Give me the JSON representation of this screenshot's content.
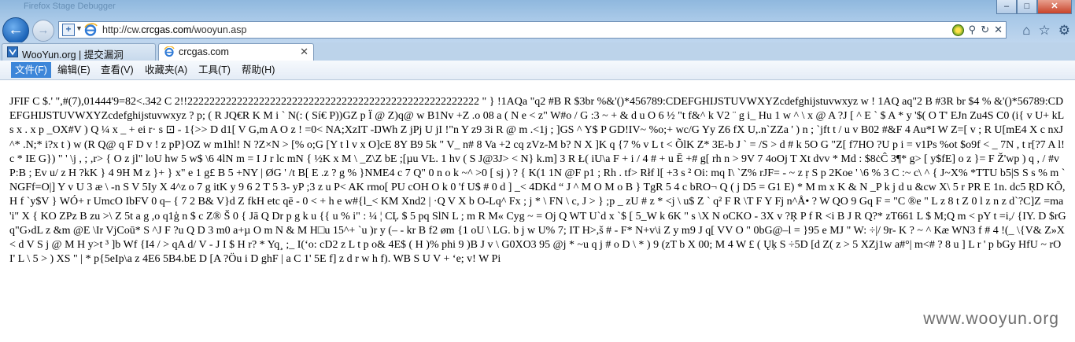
{
  "window": {
    "title": "Firefox Stage Debugger",
    "controls": {
      "minimize": "–",
      "maximize": "□",
      "close": "✕"
    }
  },
  "nav": {
    "back_glyph": "←",
    "forward_glyph": "→"
  },
  "address_bar": {
    "url_prefix": "http://cw.",
    "url_domain": "crcgas.com",
    "url_suffix": "/wooyun.asp",
    "icons": [
      "compat-view-icon",
      "ie-page-icon",
      "addon-icon",
      "search-icon",
      "refresh-icon",
      "stop-icon"
    ],
    "search_glyph": "⚲",
    "refresh_glyph": "↻",
    "stop_glyph": "✕"
  },
  "toolbar_right": {
    "home_glyph": "⌂",
    "favorites_glyph": "☆",
    "settings_glyph": "⚙"
  },
  "tabs": [
    {
      "label": "WooYun.org | 提交漏洞",
      "active": false
    },
    {
      "label": "crcgas.com",
      "active": true,
      "close": "✕"
    }
  ],
  "menu": [
    {
      "label": "文件(F)",
      "highlighted": true
    },
    {
      "label": "编辑(E)"
    },
    {
      "label": "查看(V)"
    },
    {
      "label": "收藏夹(A)"
    },
    {
      "label": "工具(T)"
    },
    {
      "label": "帮助(H)"
    }
  ],
  "content": {
    "raw_text": "JFIF    C       $.' \",#(7),01444'9=82<.342 C  2!!22222222222222222222222222222222222222222222222222222  \"        } !1AQa \"q2 #B R $3br %&'()*456789:CDEFGHIJSTUVWXYZcdefghijstuvwxyz        w ! 1AQ aq\"2 B #3R br $4 % &'()*56789:CDEFGHIJSTUVWXYZcdefghijstuvwxyz   ? p; ( R JQ€R K  M i ` N(: ( Sí€ P))GZ p   Ï  @ Z)q@ w B1Nv +Z .o 08  a (  N e < z\" W#o /  G :3 ~ + & d u O 6 ½ \"t f&^ k V2 ¨ g i_ Hu 1 w  ^  \\  x @ A ?J [ ^ E ` $ A * y  '$(  O T' EJn Zu4S C0 (i{ v U+ kL s x . x p _OX#V ) Q ¼ x _ + ei r· s ⊡  - 1{>> D d1[ V G,m A O z ! =0<   NA;XzIT -ŊWh  Z jPj U jI !\"n Y z9 3i R @ m .<1j ; ]GS  ^  Y$ P GD!IV~ %o;+ wc/G Yy Z6 fX U,.n`ZZa ' ) n ; `jft t /  u v B02 #&F 4  Au*I W Z=[ v ; R U[mE4 X  c nxJ ^* .N;* i?x t ) w (R Q@  q F D v ! z pP}OZ w m1hl! N  ?Z×N > [% o;G  [Y t l  v x O]cE 8Y B9 5k \" V_ n# 8 Va +2 cq zVz-M b? N X ]K q  {7 % v L  t  < ÕlK Z* 3E-b J ` = /S > d # k 5O G \"Z[ f7HO ?U p i  = v1Ps %ot $o9f  <  _   7N ,  t r[?7 A l!c * IE G}) \" ' \\j , ; ,r> { O z jl\" loU hw 5 w$ \\6 4lN m  = I   J r lc mN { ½K x M \\ _Z\\Z bE ;[µu VĿ. 1 hv (  S J@3J>   < N} k.m] 3 R Ł( iU\\a F  + i / 4 #  + u Ē +# g[ rh n > 9V  7 4oOj T  Xt dvv * Md : $8ċĈ 3¶* g> [ y$fE] o z }= F Ž'wp ) q , / #vP:B ; Ev u/ z H  ?kK } 4 9H M z }+ } x\" e 1 g£ B 5 +NY | ØG ' /t B[ E .z  ? g % }NME4 c 7 Q\" 0 n o k ~^ >0 [ sj ) ? { K(1 1N @F p1 ; Rh . tf> Rłf l[ +3  s ² Oi: mq I\\  `Z% rJF= - ~ z ŗ  S p 2Koe ' \\6 %  3 C :~  c\\ ^ { J~X% *TTU b5|S S s % m `NGFf=O|] Y v  U 3 æ  \\ -n S V 5Iy X 4^z o  7   g itK y 9 6   2 T 5  3- yP ;3 z u P< AK  rmo[ PU cOH O k  0 'f U$ # 0 d ] _< 4DKd “ J  ^ M O M o B } TgR   5  4 c bRO¬ Q ( j D5  = G1 E) * M m x K & N _P k j  d u &cw X\\ 5 r PR E 1n. dc5  ŖD KÕ, H f `y$V } WÓ+ r UmcO IbFV 0 q– { 7 2 B& V}d Z fkH etc qē - 0 < +  h e w#{l_< KM Xnd2 | ·Q V X b O-Lq^ Fx ;  j * \\ FN \\ c, J > } ;p  _ zU # z * <j \\ u$ Z ` q² F R \\T F Y Fj n^Å• ? W QO 9 Gq F = \"C ®e \" L z 8 t Z 0 l z n z d`?C]Z =ma 'i\" X { KO  ZPz B zu >\\ Z 5t a g ,o q1ģ n $ c Z® Š 0 { Jā Q Dr p g k u {{ u % i\" : ¼  ¦ CĻ $ 5 pq SlN L ; m R M« Cyg ~ = Oj Q WT U`d  x `$ [ 5_W k 6K \" s \\X N  oCKO - 3X v ?Ŗ P f R <i B J R Q?* zT661 L $ M;Q m < pY t =i,/ {IY.  D $rGq\"G›dL z &m @E \\Ir VjCoū* S ^J  F ?u Q D  3 m0 a+µ O m N & M H□u 15^+ `u )r y (– - kr B f2 øm {1 oU \\ LG. b j w U% 7; IT H>,š # -   F* N+v\\i Z y m9 J q[ VV O \" 0bG@–l = }95 e MJ \" W: ÷|/ 9r- K ? ~ ^ Kæ WN3 f # 4 !(_ \\{V& Z»X < d V S j @ M  H y>t  ³ ]b Wf {I4 / > qA d/  V - J I $ H r?  * Yq¸ ;_ I(‘o: cD2 z L t p o& 4E$ ( H )% phi 9 )B J v \\ G0XO3 95 @j * ~u q j # o D \\ * ) 9 (zT   b X 00; M 4 W £ (  Ųķ S ÷5D [d Z( z > 5 XZj1w a#°| m<# ? 8 u ] L r ' p bGy HfU ~ rO I' L \\ 5 >  ) XS \" | * p{5eIp\\a z 4E6 5B4.bE D  [A ?Öu i  D  ghF | a C 1' 5E f] z d r w h f).  WB S U V + ‘e; v!  W Pi"
  },
  "watermark": "www.wooyun.org"
}
